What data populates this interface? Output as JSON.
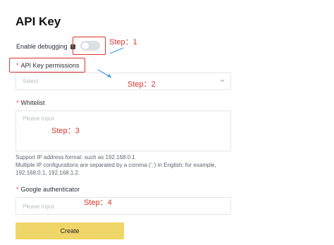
{
  "page": {
    "title": "API Key"
  },
  "debugging": {
    "label": "Enable debugging",
    "info_icon": "info-icon",
    "enabled": false
  },
  "permissions": {
    "required_mark": "*",
    "label": "API Key permissions",
    "placeholder": "Select"
  },
  "whitelist": {
    "required_mark": "*",
    "label": "Whitelist",
    "placeholder": "Please Input",
    "help_line1": "Support IP address format: such as 192.168.0.1",
    "help_line2": "Multiple IP configurations are separated by a comma (',') in English: for example,",
    "help_line3": "192.168.0.1, 192.168.1.2."
  },
  "google_auth": {
    "required_mark": "*",
    "label": "Google authenticator",
    "placeholder": "Please Input"
  },
  "create_button": {
    "label": "Create"
  },
  "annotations": {
    "color": "#d9342b",
    "arrow_color": "#3a9ad9",
    "step1": "Step：1",
    "step2": "Step：2",
    "step3": "Step：3",
    "step4": "Step：4"
  }
}
